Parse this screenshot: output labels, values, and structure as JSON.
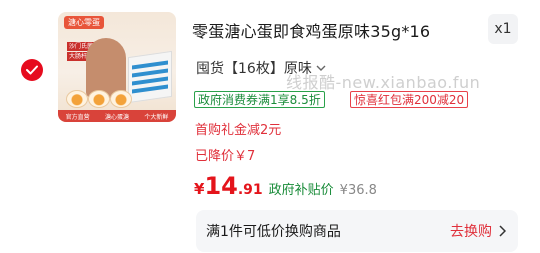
{
  "product": {
    "title": "零蛋溏心蛋即食鸡蛋原味35g*16",
    "quantity": "x1",
    "spec": "囤货【16枚】原味",
    "thumbnail": {
      "brand": "溏心零蛋",
      "tag_line1": "沙门氏菌未检出",
      "tag_line2": "大肠杆菌未检出",
      "footer_left": "官方直营",
      "footer_mid": "溏心蛋溏",
      "footer_right": "个大新鲜"
    }
  },
  "watermark": "线报酷-new.xianbao.fun",
  "promotions": {
    "gov_coupon": "政府消费券满1享8.5折",
    "red_packet": "惊喜红包满200减20",
    "first_gift": "首购礼金减2元",
    "price_drop": "已降价￥7"
  },
  "price": {
    "currency": "¥",
    "integer": "14",
    "decimal": ".91",
    "subsidy_label": "政府补贴价",
    "original": "¥36.8"
  },
  "swap": {
    "text": "满1件可低价换购商品",
    "action": "去换购"
  },
  "colors": {
    "accent_red": "#e4141b",
    "gov_green": "#1a8c3a",
    "check_red": "#e60b1e"
  }
}
